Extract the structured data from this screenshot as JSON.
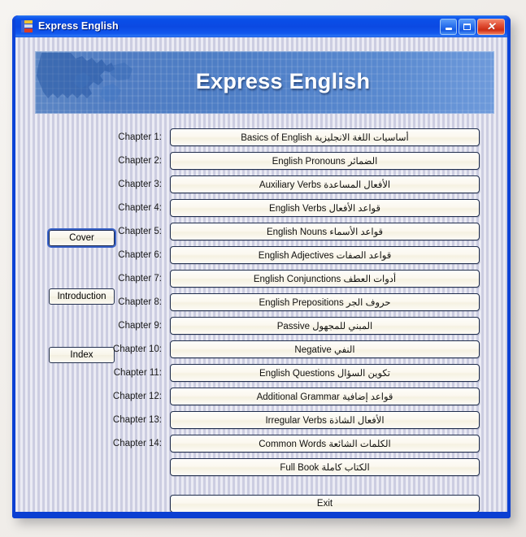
{
  "window": {
    "title": "Express English",
    "icon": "express-english-app-icon",
    "controls": {
      "minimize": "minimize-button",
      "maximize": "maximize-button",
      "close": "close-button",
      "close_glyph": "✕"
    },
    "colors": {
      "titlebar_blue": "#0b49e2",
      "frame_blue": "#0a3fd8",
      "client_bg": "#d2d3e6",
      "banner_blue": "#4f7cc2",
      "button_cream": "#faf7ec",
      "button_border": "#1f2d4c",
      "close_red": "#cd2e14"
    }
  },
  "banner": {
    "title": "Express English",
    "graphic": "world-map-silhouette"
  },
  "sidebar": {
    "items": [
      {
        "label": "Cover",
        "focused": true
      },
      {
        "label": "Introduction",
        "focused": false
      },
      {
        "label": "Index",
        "focused": false
      }
    ]
  },
  "chapters": [
    {
      "label": "Chapter 1:",
      "title": "Basics of English أساسيات اللغة الانجليزية"
    },
    {
      "label": "Chapter 2:",
      "title": "English Pronouns الضمائر"
    },
    {
      "label": "Chapter 3:",
      "title": "Auxiliary Verbs الأفعال المساعدة"
    },
    {
      "label": "Chapter 4:",
      "title": "English Verbs قواعد الأفعال"
    },
    {
      "label": "Chapter 5:",
      "title": "English Nouns قواعد الأسماء"
    },
    {
      "label": "Chapter 6:",
      "title": "English Adjectives قواعد الصفات"
    },
    {
      "label": "Chapter 7:",
      "title": "English Conjunctions أدوات العطف"
    },
    {
      "label": "Chapter 8:",
      "title": "English Prepositions حروف الجر"
    },
    {
      "label": "Chapter 9:",
      "title": "Passive المبني للمجهول"
    },
    {
      "label": "Chapter 10:",
      "title": "Negative النفي"
    },
    {
      "label": "Chapter 11:",
      "title": "English Questions تكوين السؤال"
    },
    {
      "label": "Chapter 12:",
      "title": "Additional Grammar قواعد إضافية"
    },
    {
      "label": "Chapter 13:",
      "title": "Irregular Verbs الأفعال الشاذة"
    },
    {
      "label": "Chapter 14:",
      "title": "Common Words الكلمات الشائعة"
    },
    {
      "label": "",
      "title": "Full Book الكتاب كاملة"
    }
  ],
  "exit": {
    "label": "Exit"
  }
}
